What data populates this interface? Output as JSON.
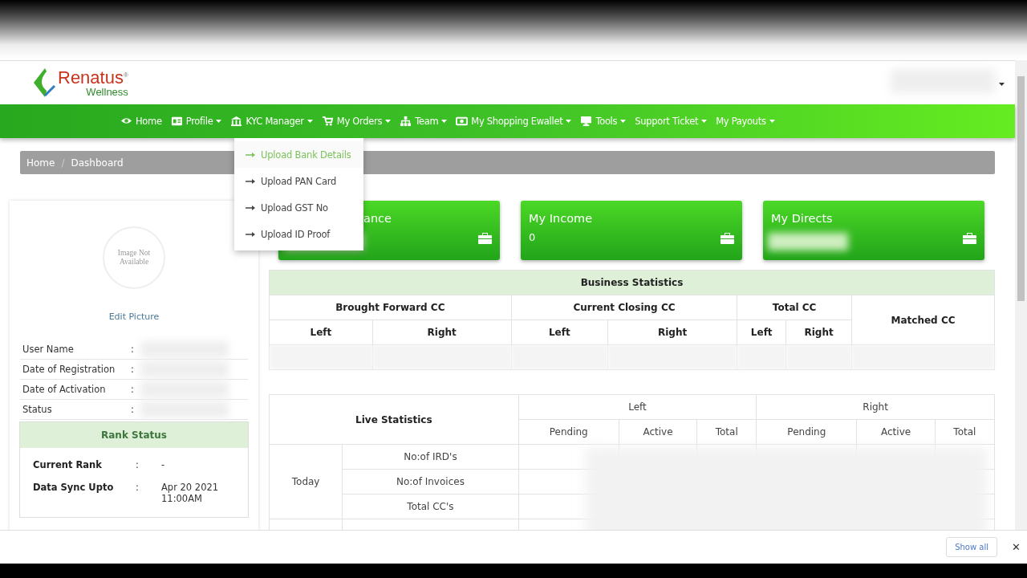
{
  "logo": {
    "name": "Renatus",
    "sub": "Wellness",
    "mark": "®"
  },
  "nav": [
    {
      "label": "Home",
      "dropdown": false
    },
    {
      "label": "Profile",
      "dropdown": true
    },
    {
      "label": "KYC Manager",
      "dropdown": true
    },
    {
      "label": "My Orders",
      "dropdown": true
    },
    {
      "label": "Team",
      "dropdown": true
    },
    {
      "label": "My Shopping Ewallet",
      "dropdown": true
    },
    {
      "label": "Tools",
      "dropdown": true
    },
    {
      "label": "Support Ticket",
      "dropdown": true
    },
    {
      "label": "My Payouts",
      "dropdown": true
    }
  ],
  "dropdown": {
    "items": [
      {
        "label": "Upload Bank Details",
        "selected": true
      },
      {
        "label": "Upload PAN Card",
        "selected": false
      },
      {
        "label": "Upload GST No",
        "selected": false
      },
      {
        "label": "Upload ID Proof",
        "selected": false
      }
    ]
  },
  "breadcrumb": {
    "separator": "/",
    "items": [
      "Home",
      "Dashboard"
    ]
  },
  "profile": {
    "photo": "Image Not Available",
    "edit": "Edit Picture",
    "fields": [
      {
        "label": "User Name",
        "sep": ":"
      },
      {
        "label": "Date of Registration",
        "sep": ":"
      },
      {
        "label": "Date of Activation",
        "sep": ":"
      },
      {
        "label": "Status",
        "sep": ":"
      }
    ],
    "rank": {
      "title": "Rank Status",
      "rows": [
        {
          "label": "Current Rank",
          "sep": ":",
          "value": "-"
        },
        {
          "label": "Data Sync Upto",
          "sep": ":",
          "value": "Apr 20 2021 11:00AM"
        }
      ]
    }
  },
  "cards": [
    {
      "title": "ance",
      "covered": true
    },
    {
      "title": "My Income",
      "value": "0",
      "covered": false
    },
    {
      "title": "My Directs",
      "covered": false
    }
  ],
  "business": {
    "title": "Business Statistics",
    "groups": [
      "Brought Forward CC",
      "Current Closing CC",
      "Total CC"
    ],
    "sub": [
      "Left",
      "Right",
      "Left",
      "Right",
      "Left",
      "Right"
    ],
    "last": "Matched CC"
  },
  "live": {
    "title": "Live Statistics",
    "sides": [
      "Left",
      "Right"
    ],
    "cols": [
      "Pending",
      "Active",
      "Total",
      "Pending",
      "Active",
      "Total"
    ],
    "period": "Today",
    "rows": [
      "No:of IRD's",
      "No:of Invoices",
      "Total CC's"
    ]
  },
  "downloads": {
    "show_all": "Show all",
    "close": "✕"
  }
}
